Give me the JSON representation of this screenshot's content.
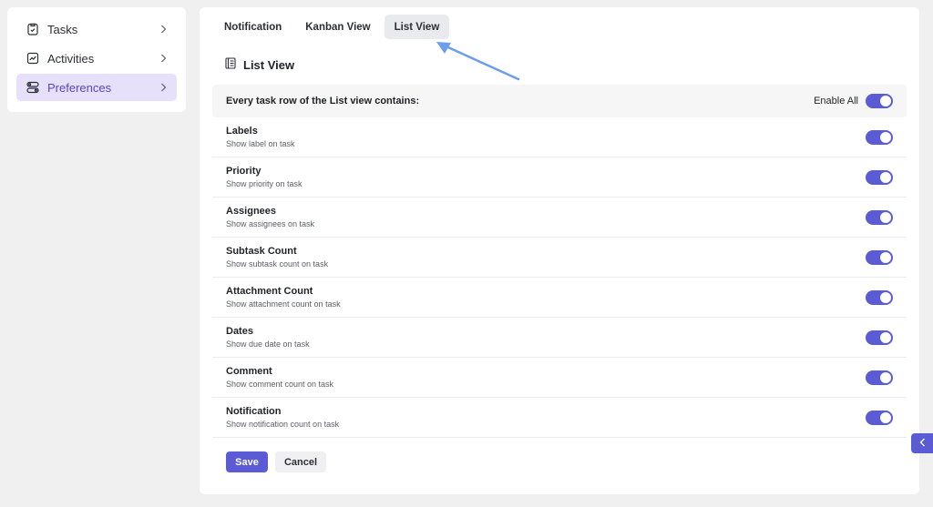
{
  "sidebar": {
    "items": [
      {
        "label": "Tasks",
        "icon": "clipboard-icon",
        "active": false
      },
      {
        "label": "Activities",
        "icon": "activity-chart-icon",
        "active": false
      },
      {
        "label": "Preferences",
        "icon": "preferences-toggle-icon",
        "active": true
      }
    ]
  },
  "tabs": [
    {
      "label": "Notification",
      "active": false
    },
    {
      "label": "Kanban View",
      "active": false
    },
    {
      "label": "List View",
      "active": true
    }
  ],
  "page_title": "List View",
  "header": {
    "text": "Every task row of the List view contains:",
    "enable_all_label": "Enable All",
    "enable_all_on": true
  },
  "rows": [
    {
      "title": "Labels",
      "subtitle": "Show label on task",
      "on": true
    },
    {
      "title": "Priority",
      "subtitle": "Show priority on task",
      "on": true
    },
    {
      "title": "Assignees",
      "subtitle": "Show assignees on task",
      "on": true
    },
    {
      "title": "Subtask Count",
      "subtitle": "Show subtask count on task",
      "on": true
    },
    {
      "title": "Attachment Count",
      "subtitle": "Show attachment count on task",
      "on": true
    },
    {
      "title": "Dates",
      "subtitle": "Show due date on task",
      "on": true
    },
    {
      "title": "Comment",
      "subtitle": "Show comment count on task",
      "on": true
    },
    {
      "title": "Notification",
      "subtitle": "Show notification count on task",
      "on": true
    }
  ],
  "actions": {
    "save_label": "Save",
    "cancel_label": "Cancel"
  },
  "colors": {
    "accent": "#5b5bd6",
    "active_nav_bg": "#e6e0fb",
    "active_nav_text": "#5b45c4",
    "annotation_arrow": "#6d9eeb"
  }
}
